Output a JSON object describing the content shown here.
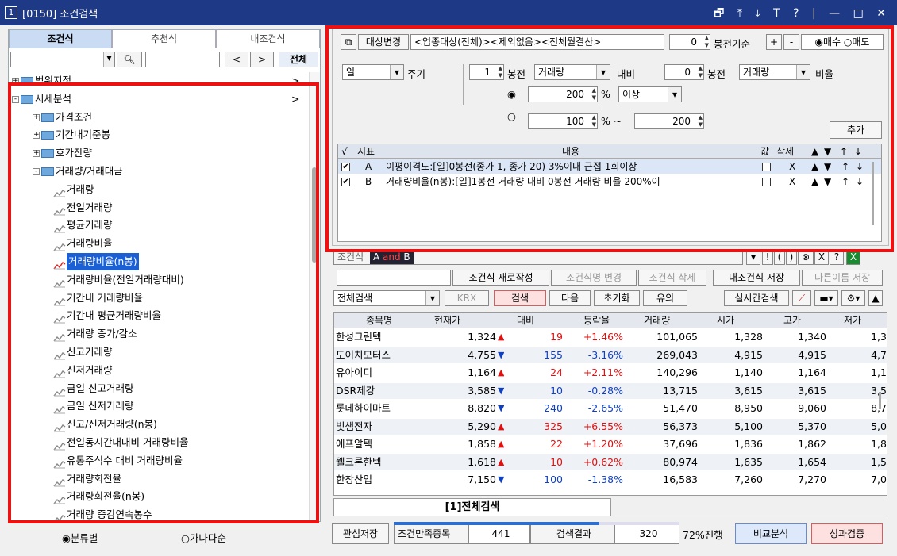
{
  "window": {
    "badge": "1",
    "title": "[0150] 조건검색",
    "controls": "🗗 ⤒ ⤓ T ? | — □ ✕"
  },
  "left": {
    "tabs": [
      "조건식",
      "추천식",
      "내조건식"
    ],
    "search": {
      "prev": "<",
      "next": ">",
      "all": "전체"
    },
    "tree": [
      {
        "label": "범위지정",
        "level": 0,
        "type": "folder",
        "expand": "+",
        "arrow": ">"
      },
      {
        "label": "시세분석",
        "level": 0,
        "type": "folder",
        "expand": "-",
        "arrow": ">"
      },
      {
        "label": "가격조건",
        "level": 1,
        "type": "folder",
        "expand": "+"
      },
      {
        "label": "기간내기준봉",
        "level": 1,
        "type": "folder",
        "expand": "+"
      },
      {
        "label": "호가잔량",
        "level": 1,
        "type": "folder",
        "expand": "+"
      },
      {
        "label": "거래량/거래대금",
        "level": 1,
        "type": "folder",
        "expand": "-"
      },
      {
        "label": "거래량",
        "level": 2,
        "type": "item"
      },
      {
        "label": "전일거래량",
        "level": 2,
        "type": "item"
      },
      {
        "label": "평균거래량",
        "level": 2,
        "type": "item"
      },
      {
        "label": "거래량비율",
        "level": 2,
        "type": "item"
      },
      {
        "label": "거래량비율(n봉)",
        "level": 2,
        "type": "item",
        "selected": true
      },
      {
        "label": "거래량비율(전일거래량대비)",
        "level": 2,
        "type": "item"
      },
      {
        "label": "기간내 거래량비율",
        "level": 2,
        "type": "item"
      },
      {
        "label": "기간내 평균거래량비율",
        "level": 2,
        "type": "item"
      },
      {
        "label": "거래량 증가/감소",
        "level": 2,
        "type": "item"
      },
      {
        "label": "신고거래량",
        "level": 2,
        "type": "item"
      },
      {
        "label": "신저거래량",
        "level": 2,
        "type": "item"
      },
      {
        "label": "금일 신고거래량",
        "level": 2,
        "type": "item"
      },
      {
        "label": "금일 신저거래량",
        "level": 2,
        "type": "item"
      },
      {
        "label": "신고/신저거래량(n봉)",
        "level": 2,
        "type": "item"
      },
      {
        "label": "전일동시간대대비 거래량비율",
        "level": 2,
        "type": "item"
      },
      {
        "label": "유통주식수 대비 거래량비율",
        "level": 2,
        "type": "item"
      },
      {
        "label": "거래량회전율",
        "level": 2,
        "type": "item"
      },
      {
        "label": "거래량회전율(n봉)",
        "level": 2,
        "type": "item"
      },
      {
        "label": "거래량 증감연속봉수",
        "level": 2,
        "type": "item"
      }
    ],
    "sort_options": [
      "분류별",
      "가나다순"
    ]
  },
  "top": {
    "target_change": "대상변경",
    "target_text": "<업종대상(전체)><제외없음><전체월결산>",
    "bong_value": "0",
    "bong_label": "봉전기준",
    "plus": "+",
    "minus": "-",
    "buy": "매수",
    "sell": "매도",
    "period_select": "일",
    "period_label": "주기",
    "n1": "1",
    "bong1": "봉전",
    "sel1": "거래량",
    "compare": "대비",
    "n2": "0",
    "bong2": "봉전",
    "sel2": "거래량",
    "ratio": "비율",
    "pct1": "200",
    "pct_unit": "%",
    "cond_sel": "이상",
    "range_from": "100",
    "range_sep": "% ~",
    "range_to": "200",
    "add_btn": "추가"
  },
  "conditions": {
    "headers": [
      "√",
      "지표",
      "내용",
      "값",
      "삭제",
      "▲",
      "▼",
      "↑",
      "↓"
    ],
    "rows": [
      {
        "key": "A",
        "content": "이평이격도:[일]0봉전(종가 1, 종가 20) 3%이내 근접 1회이상",
        "del": "X"
      },
      {
        "key": "B",
        "content": "거래량비율(n봉):[일]1봉전 거래량 대비 0봉전 거래량 비율 200%이",
        "del": "X"
      }
    ]
  },
  "formula": {
    "label": "조건식",
    "a": "A",
    "and": "and",
    "b": "B",
    "ops": [
      "!",
      "(",
      ")",
      "⊗",
      "X",
      "?"
    ]
  },
  "actions": {
    "new": "조건식 새로작성",
    "rename": "조건식명 변경",
    "delete": "조건식 삭제",
    "save_mine": "내조건식 저장",
    "save_as": "다른이름 저장"
  },
  "search_bar": {
    "scope": "전체검색",
    "krx": "KRX",
    "search": "검색",
    "next": "다음",
    "reset": "초기화",
    "caution": "유의",
    "realtime": "실시간검색"
  },
  "grid": {
    "headers": [
      "종목명",
      "현재가",
      "대비",
      "등락율",
      "거래량",
      "시가",
      "고가",
      "저가"
    ],
    "rows": [
      {
        "name": "한성크린텍",
        "price": "1,324",
        "dir": "up",
        "diff": "19",
        "rate": "+1.46%",
        "vol": "101,065",
        "open": "1,328",
        "high": "1,340",
        "low": "1,3"
      },
      {
        "name": "도이치모터스",
        "price": "4,755",
        "dir": "down",
        "diff": "155",
        "rate": "-3.16%",
        "vol": "269,043",
        "open": "4,915",
        "high": "4,915",
        "low": "4,7"
      },
      {
        "name": "유아이디",
        "price": "1,164",
        "dir": "up",
        "diff": "24",
        "rate": "+2.11%",
        "vol": "140,296",
        "open": "1,140",
        "high": "1,164",
        "low": "1,1"
      },
      {
        "name": "DSR제강",
        "price": "3,585",
        "dir": "down",
        "diff": "10",
        "rate": "-0.28%",
        "vol": "13,715",
        "open": "3,615",
        "high": "3,615",
        "low": "3,5"
      },
      {
        "name": "롯데하이마트",
        "price": "8,820",
        "dir": "down",
        "diff": "240",
        "rate": "-2.65%",
        "vol": "51,470",
        "open": "8,950",
        "high": "9,060",
        "low": "8,7"
      },
      {
        "name": "빛샘전자",
        "price": "5,290",
        "dir": "up",
        "diff": "325",
        "rate": "+6.55%",
        "vol": "56,373",
        "open": "5,100",
        "high": "5,370",
        "low": "5,0"
      },
      {
        "name": "에프알텍",
        "price": "1,858",
        "dir": "up",
        "diff": "22",
        "rate": "+1.20%",
        "vol": "37,696",
        "open": "1,836",
        "high": "1,862",
        "low": "1,8"
      },
      {
        "name": "웰크론한텍",
        "price": "1,618",
        "dir": "up",
        "diff": "10",
        "rate": "+0.62%",
        "vol": "80,974",
        "open": "1,635",
        "high": "1,654",
        "low": "1,5"
      },
      {
        "name": "한창산업",
        "price": "7,150",
        "dir": "down",
        "diff": "100",
        "rate": "-1.38%",
        "vol": "16,583",
        "open": "7,260",
        "high": "7,270",
        "low": "7,0"
      }
    ]
  },
  "bottom": {
    "tab": "[1]전체검색",
    "interest_save": "관심저장",
    "satisfied_label": "조건만족종목",
    "satisfied_count": "441",
    "result_label": "검색결과",
    "result_count": "320",
    "progress": "72%진행",
    "progress_value": 72,
    "compare": "비교분석",
    "verify": "성과검증"
  },
  "colors": {
    "highlight_box": "#ee1111",
    "title_bar": "#1e3a86",
    "up": "#e01010",
    "down": "#1040c0"
  }
}
